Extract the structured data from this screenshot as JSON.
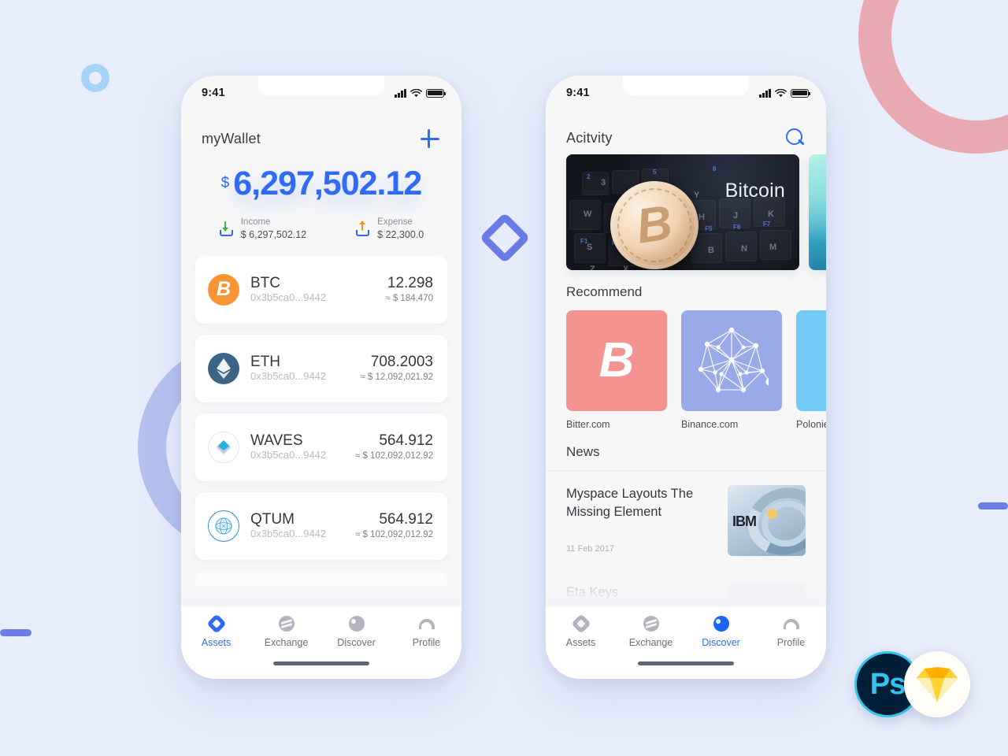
{
  "theme": {
    "background": "#e8edfb",
    "accent_blue": "#2f6bf5",
    "deco_pink": "#e9a9b3",
    "deco_purple": "#b6c2ef",
    "deco_cyan": "#a8d3f7",
    "deco_indigo": "#6a7ce6"
  },
  "wallet_screen": {
    "status": {
      "time": "9:41",
      "signal_icon": "signal-bars-icon",
      "wifi_icon": "wifi-icon",
      "battery_icon": "battery-full-icon"
    },
    "header": {
      "title": "myWallet",
      "add_icon": "plus-icon"
    },
    "balance": {
      "currency_symbol": "$",
      "amount": "6,297,502.12"
    },
    "summary": [
      {
        "icon": "income-arrow-down-icon",
        "label": "Income",
        "value": "$ 6,297,502.12"
      },
      {
        "icon": "expense-arrow-up-icon",
        "label": "Expense",
        "value": "$ 22,300.0"
      }
    ],
    "coins": [
      {
        "icon": "bitcoin-coin-icon",
        "symbol": "BTC",
        "address": "0x3b5ca0...9442",
        "amount": "12.298",
        "fiat": "≈ $ 184,470"
      },
      {
        "icon": "ethereum-coin-icon",
        "symbol": "ETH",
        "address": "0x3b5ca0...9442",
        "amount": "708.2003",
        "fiat": "≈ $ 12,092,021.92"
      },
      {
        "icon": "waves-coin-icon",
        "symbol": "WAVES",
        "address": "0x3b5ca0...9442",
        "amount": "564.912",
        "fiat": "≈ $ 102,092,012.92"
      },
      {
        "icon": "qtum-coin-icon",
        "symbol": "QTUM",
        "address": "0x3b5ca0...9442",
        "amount": "564.912",
        "fiat": "≈ $ 102,092,012.92"
      }
    ],
    "tabs": [
      {
        "icon": "assets-diamond-icon",
        "label": "Assets",
        "active": true
      },
      {
        "icon": "exchange-waves-icon",
        "label": "Exchange",
        "active": false
      },
      {
        "icon": "discover-circle-icon",
        "label": "Discover",
        "active": false
      },
      {
        "icon": "profile-person-icon",
        "label": "Profile",
        "active": false
      }
    ]
  },
  "activity_screen": {
    "status": {
      "time": "9:41",
      "signal_icon": "signal-bars-icon",
      "wifi_icon": "wifi-icon",
      "battery_icon": "battery-full-icon"
    },
    "header": {
      "title": "Acitvity",
      "search_icon": "search-icon"
    },
    "banners": [
      {
        "image": "bitcoin-coin-on-keyboard-photo",
        "caption": "Bitcoin"
      },
      {
        "image": "aurora-photo",
        "caption": ""
      }
    ],
    "recommend": {
      "section_title": "Recommend",
      "items": [
        {
          "icon": "bitcoin-symbol-icon",
          "label": "Bitter.com",
          "color": "#f49390"
        },
        {
          "icon": "binance-network-icon",
          "label": "Binance.com",
          "color": "#98aae8"
        },
        {
          "icon": "poloniex-icon",
          "label": "Poloniex.com",
          "color": "#72caf5"
        }
      ]
    },
    "news": {
      "section_title": "News",
      "items": [
        {
          "headline": "Myspace Layouts The Missing Element",
          "date": "11 Feb 2017",
          "thumb": "ibm-server-ring-photo"
        },
        {
          "headline": "Eta Keys",
          "date": "",
          "thumb": "person-portrait-photo"
        }
      ]
    },
    "tabs": [
      {
        "icon": "assets-diamond-icon",
        "label": "Assets",
        "active": false
      },
      {
        "icon": "exchange-waves-icon",
        "label": "Exchange",
        "active": false
      },
      {
        "icon": "discover-circle-icon",
        "label": "Discover",
        "active": true
      },
      {
        "icon": "profile-person-icon",
        "label": "Profile",
        "active": false
      }
    ]
  },
  "brand_logos": [
    {
      "name": "photoshop-logo",
      "text": "Ps"
    },
    {
      "name": "sketch-logo",
      "text": ""
    }
  ]
}
